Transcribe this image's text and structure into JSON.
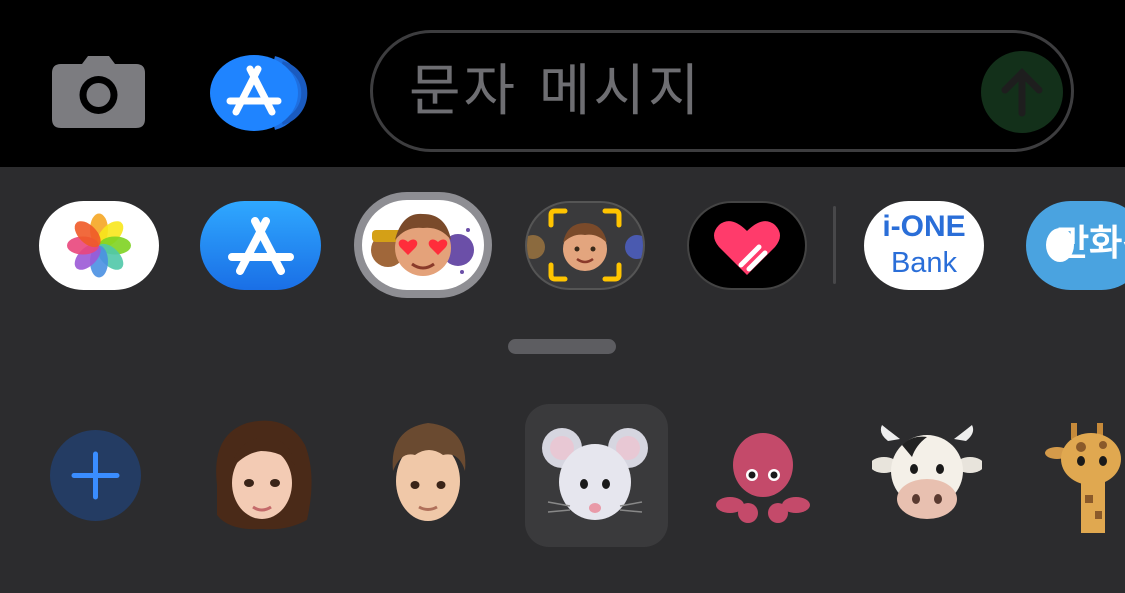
{
  "message_field": {
    "placeholder": "문자 메시지"
  },
  "app_drawer": {
    "apps": [
      {
        "name": "photos",
        "icon": "photos-icon"
      },
      {
        "name": "app-store",
        "icon": "app-store-icon"
      },
      {
        "name": "memoji-stickers",
        "icon": "memoji-icon",
        "selected": true
      },
      {
        "name": "memoji-camera",
        "icon": "memoji-camera-icon"
      },
      {
        "name": "digital-touch",
        "icon": "heart-icon"
      },
      {
        "name": "bank",
        "icon": "bank-icon",
        "label_line1": "i-ONE",
        "label_line2": "Bank"
      },
      {
        "name": "manhwa",
        "icon": "manhwa-icon",
        "label": "만화경"
      }
    ]
  },
  "stickers": [
    {
      "name": "add-memoji",
      "icon": "plus-icon"
    },
    {
      "name": "woman-memoji",
      "icon": "woman-memoji-icon"
    },
    {
      "name": "boy-memoji",
      "icon": "boy-memoji-icon"
    },
    {
      "name": "mouse-animoji",
      "icon": "mouse-icon",
      "selected": true
    },
    {
      "name": "octopus-animoji",
      "icon": "octopus-icon"
    },
    {
      "name": "cow-animoji",
      "icon": "cow-icon"
    },
    {
      "name": "giraffe-animoji",
      "icon": "giraffe-icon"
    }
  ],
  "colors": {
    "accent": "#1a7bf5",
    "send": "#13301a",
    "background": "#2c2c2e"
  }
}
